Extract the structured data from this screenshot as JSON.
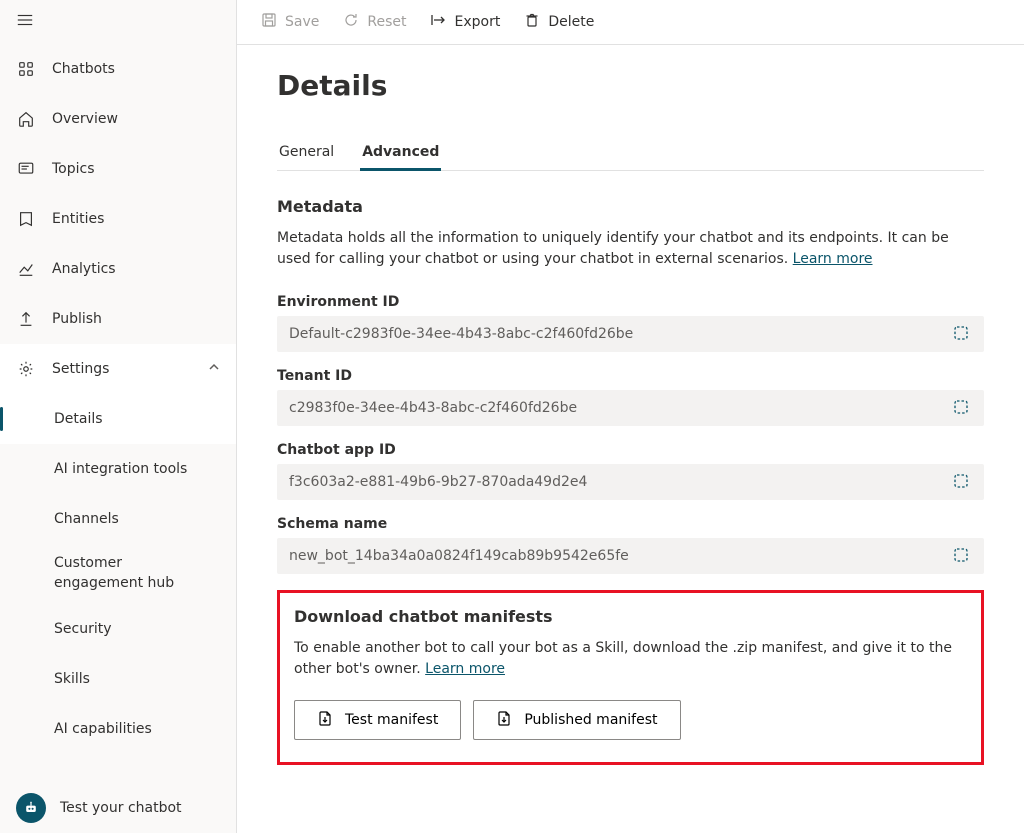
{
  "sidebar": {
    "items": [
      {
        "id": "chatbots",
        "label": "Chatbots",
        "icon": "apps-icon"
      },
      {
        "id": "overview",
        "label": "Overview",
        "icon": "home-icon"
      },
      {
        "id": "topics",
        "label": "Topics",
        "icon": "chat-icon"
      },
      {
        "id": "entities",
        "label": "Entities",
        "icon": "entities-icon"
      },
      {
        "id": "analytics",
        "label": "Analytics",
        "icon": "chart-icon"
      },
      {
        "id": "publish",
        "label": "Publish",
        "icon": "publish-icon"
      },
      {
        "id": "settings",
        "label": "Settings",
        "icon": "settings-icon",
        "expanded": true
      }
    ],
    "settings_children": [
      {
        "id": "details",
        "label": "Details",
        "active": true
      },
      {
        "id": "ai-tools",
        "label": "AI integration tools"
      },
      {
        "id": "channels",
        "label": "Channels"
      },
      {
        "id": "engagement",
        "label": "Customer engagement hub"
      },
      {
        "id": "security",
        "label": "Security"
      },
      {
        "id": "skills",
        "label": "Skills"
      },
      {
        "id": "ai-cap",
        "label": "AI capabilities"
      }
    ],
    "bottom": {
      "label": "Test your chatbot"
    }
  },
  "commandBar": {
    "save": "Save",
    "reset": "Reset",
    "export": "Export",
    "delete": "Delete"
  },
  "page": {
    "title": "Details",
    "tabs": [
      {
        "id": "general",
        "label": "General",
        "active": false
      },
      {
        "id": "advanced",
        "label": "Advanced",
        "active": true
      }
    ],
    "metadata": {
      "heading": "Metadata",
      "desc": "Metadata holds all the information to uniquely identify your chatbot and its endpoints. It can be used for calling your chatbot or using your chatbot in external scenarios. ",
      "learnMore": "Learn more"
    },
    "fields": [
      {
        "label": "Environment ID",
        "value": "Default-c2983f0e-34ee-4b43-8abc-c2f460fd26be"
      },
      {
        "label": "Tenant ID",
        "value": "c2983f0e-34ee-4b43-8abc-c2f460fd26be"
      },
      {
        "label": "Chatbot app ID",
        "value": "f3c603a2-e881-49b6-9b27-870ada49d2e4"
      },
      {
        "label": "Schema name",
        "value": "new_bot_14ba34a0a0824f149cab89b9542e65fe"
      }
    ],
    "manifests": {
      "heading": "Download chatbot manifests",
      "desc": "To enable another bot to call your bot as a Skill, download the .zip manifest, and give it to the other bot's owner. ",
      "learnMore": "Learn more",
      "testBtn": "Test manifest",
      "pubBtn": "Published manifest"
    }
  }
}
